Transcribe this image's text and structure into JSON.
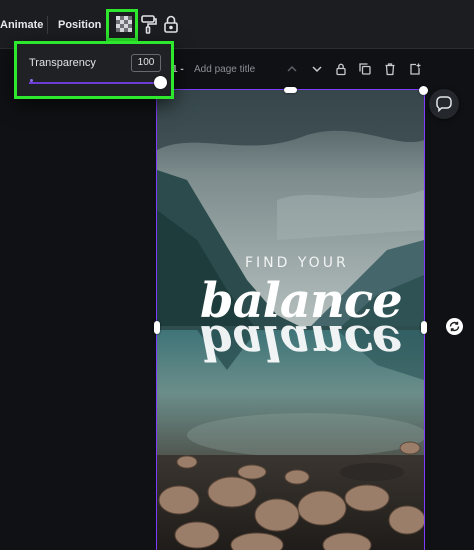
{
  "toolbar": {
    "animate_label": "Animate",
    "position_label": "Position",
    "icons": [
      "transparency-icon",
      "paint-format-icon",
      "lock-icon"
    ]
  },
  "transparency": {
    "label": "Transparency",
    "value": "100",
    "level": 1.0
  },
  "page_header": {
    "page_number": "1 -",
    "title_placeholder": "Add page title",
    "icons": [
      "chevron-up-icon",
      "chevron-down-icon",
      "lock-icon",
      "duplicate-icon",
      "trash-icon",
      "add-page-icon"
    ]
  },
  "design": {
    "headline_small": "FIND YOUR",
    "headline_large": "balance",
    "headline_reflection": "balance"
  },
  "colors": {
    "highlight": "#2ee82e",
    "accent": "#7d3cff",
    "background": "#0f1114",
    "toolbar": "#1b1d20"
  }
}
